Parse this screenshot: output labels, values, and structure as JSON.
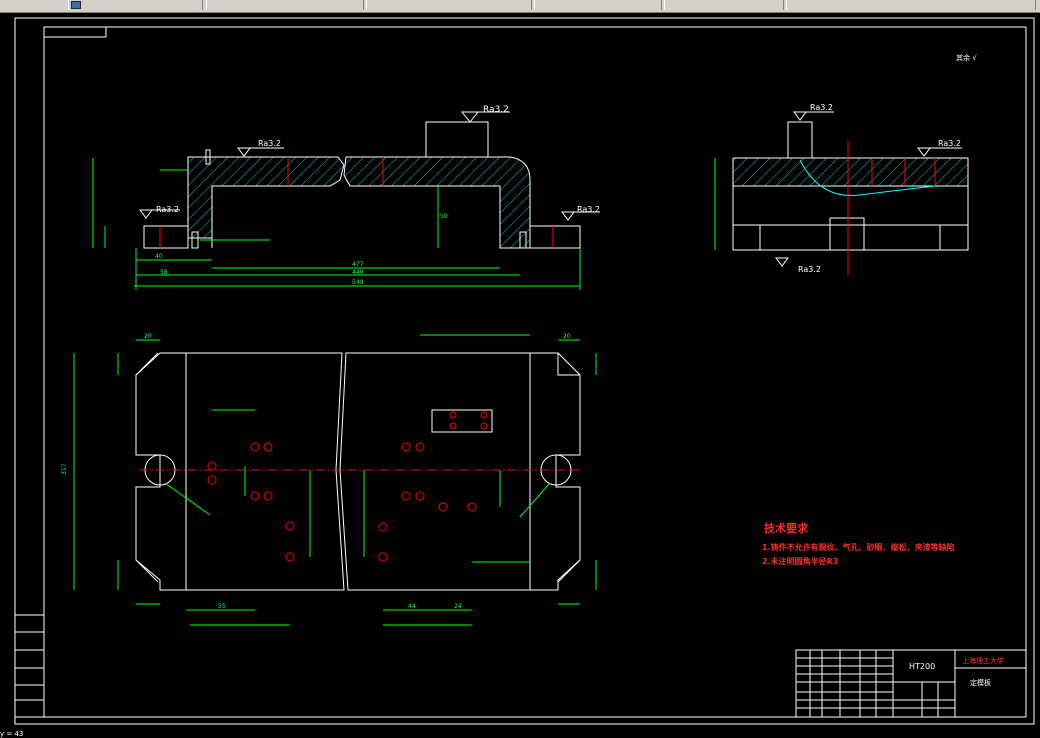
{
  "tabs": [
    {
      "label": "",
      "has_icon": true
    },
    {
      "label": "",
      "has_icon": false
    },
    {
      "label": "",
      "has_icon": false
    },
    {
      "label": "",
      "has_icon": false
    },
    {
      "label": "",
      "has_icon": false
    },
    {
      "label": "",
      "has_icon": false
    }
  ],
  "drawing": {
    "roughness_main": "Ra3.2",
    "roughness_marks": [
      "Ra3.2",
      "Ra3.2",
      "Ra3.2",
      "Ra3.2",
      "Ra3.2",
      "Ra3.2",
      "Ra3.2"
    ],
    "corner_note": "其余 √",
    "tech_req_title": "技术要求",
    "tech_req_1": "1.铸件不允许有裂纹、气孔、砂眼、缩松、夹渣等缺陷",
    "tech_req_2": "2.未注明圆角半径R3",
    "dims_front": {
      "d1": "40",
      "d2": "58",
      "d3": "477",
      "d4": "449",
      "d5": "549",
      "d6": "50"
    },
    "dims_plan": {
      "w": "55",
      "w2": "44",
      "w3": "24",
      "h": "317",
      "c1": "20",
      "c2": "20"
    }
  },
  "title_block": {
    "material": "HT200",
    "school": "上海理工大学",
    "part_name": "定模板"
  },
  "colors": {
    "outline": "#ffffff",
    "dimension": "#00ff00",
    "center": "#ff0000",
    "hatch": "#00ffff",
    "accent_yellow": "#ffff00"
  },
  "status": {
    "text": "y = 43"
  }
}
